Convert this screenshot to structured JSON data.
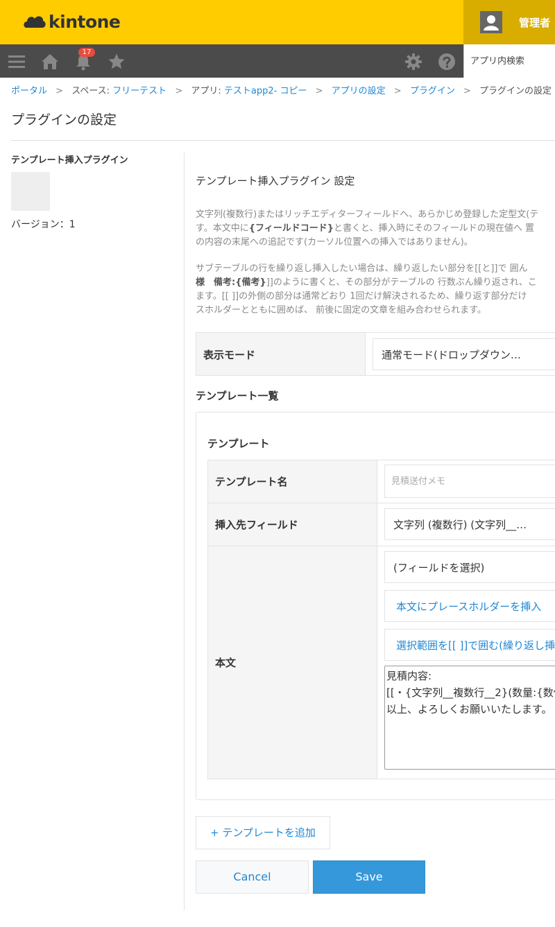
{
  "header": {
    "logo_text": "kintone",
    "user_name": "管理者",
    "search_placeholder": "アプリ内検索",
    "notification_count": "17"
  },
  "breadcrumb": {
    "portal": "ポータル",
    "space_prefix": "スペース: ",
    "space": "フリーテスト",
    "app_prefix": "アプリ: ",
    "app": "テストapp2- コピー",
    "app_settings": "アプリの設定",
    "plugins": "プラグイン",
    "current": "プラグインの設定",
    "separator": ">"
  },
  "page_title": "プラグインの設定",
  "plugin": {
    "name": "テンプレート挿入プラグイン",
    "version": "バージョン：1"
  },
  "settings": {
    "title": "テンプレート挿入プラグイン 設定",
    "desc1": {
      "l1": "文字列(複数行)またはリッチエディターフィールドへ、あらかじめ登録した定型文(テ",
      "l2a": "す。本文中に",
      "l2b": "{フィールドコード}",
      "l2c": "と書くと、挿入時にそのフィールドの現在値へ 置",
      "l3": "の内容の末尾への追記です(カーソル位置への挿入ではありません)。"
    },
    "desc2": {
      "l1": "サブテーブルの行を繰り返し挿入したい場合は、繰り返したい部分を[[と]]で 囲ん",
      "l2a": "様　備考:",
      "l2b": "{備考}",
      "l2c": "]]のように書くと、その部分がテーブルの 行数ぶん繰り返され、こ",
      "l3": "ます。[[ ]]の外側の部分は通常どおり 1回だけ解決されるため、繰り返す部分だけ",
      "l4": "スホルダーとともに囲めば、 前後に固定の文章を組み合わせられます。"
    },
    "mode_label": "表示モード",
    "mode_value": "通常モード(ドロップダウン…",
    "list_title": "テンプレート一覧",
    "template_heading": "テンプレート",
    "name_label": "テンプレート名",
    "name_placeholder": "見積送付メモ",
    "field_label": "挿入先フィールド",
    "field_value": "文字列 (複数行) (文字列__…",
    "body_label": "本文",
    "body_field_select": "(フィールドを選択)",
    "insert_placeholder_btn": "本文にプレースホルダーを挿入",
    "wrap_btn": "選択範囲を[[ ]]で囲む(繰り返し挿",
    "body_lines": [
      "見積内容:",
      "[[・{文字列__複数行__2}(数量:{数値",
      "以上、よろしくお願いいたします。"
    ],
    "add_template": "+ テンプレートを追加",
    "cancel": "Cancel",
    "save": "Save"
  },
  "colors": {
    "header_bg": "#ffcc00",
    "nav_bg": "#4b4b4b",
    "link": "#1e87d6",
    "primary": "#3498db",
    "badge": "#e74c3c"
  }
}
